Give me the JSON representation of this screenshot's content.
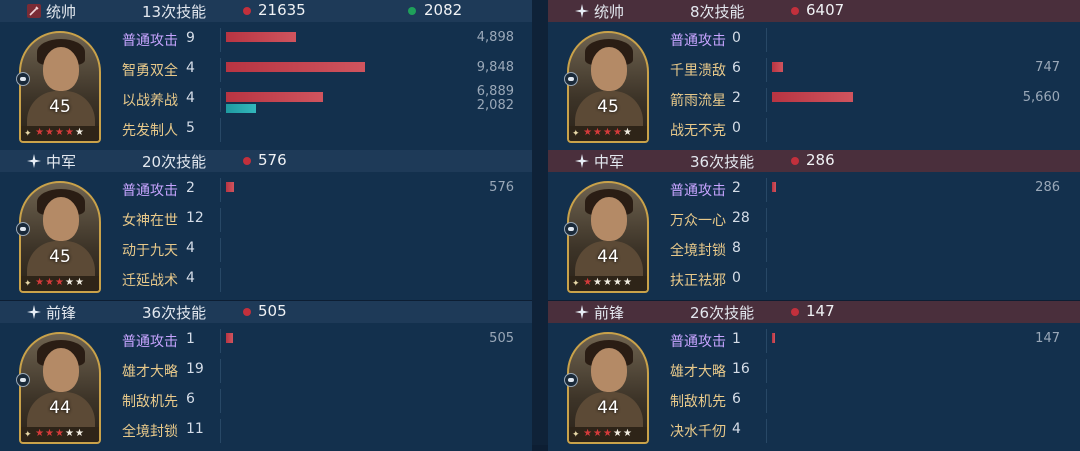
{
  "colors": {
    "damage_dot": "#c2303c",
    "heal_dot": "#1fa05a",
    "damage_bar": "#c2404b",
    "heal_bar": "#22a8ad",
    "basic_skill": "#c7a4ff",
    "skill": "#e8c98a"
  },
  "left": [
    {
      "role": "统帅",
      "role_icon": "sword-icon",
      "skills": "13次技能",
      "damage": "21635",
      "heal": "2082",
      "level": "45",
      "stars_red": 4,
      "stars_total": 5,
      "rows": [
        {
          "skill": "普通攻击",
          "basic": true,
          "count": "9",
          "value": "4,898",
          "fraction": 0.3
        },
        {
          "skill": "智勇双全",
          "basic": false,
          "count": "4",
          "value": "9,848",
          "fraction": 0.6
        },
        {
          "skill": "以战养战",
          "basic": false,
          "count": "4",
          "value": "6,889",
          "heal_value": "2,082",
          "fraction": 0.42,
          "heal_fraction": 0.13
        },
        {
          "skill": "先发制人",
          "basic": false,
          "count": "5"
        }
      ]
    },
    {
      "role": "中军",
      "role_icon": "spark-icon",
      "skills": "20次技能",
      "damage": "576",
      "level": "45",
      "stars_red": 3,
      "stars_total": 5,
      "rows": [
        {
          "skill": "普通攻击",
          "basic": true,
          "count": "2",
          "value": "576",
          "fraction": 0.035
        },
        {
          "skill": "女神在世",
          "basic": false,
          "count": "12"
        },
        {
          "skill": "动于九天",
          "basic": false,
          "count": "4"
        },
        {
          "skill": "迁延战术",
          "basic": false,
          "count": "4"
        }
      ]
    },
    {
      "role": "前锋",
      "role_icon": "spark-icon",
      "skills": "36次技能",
      "damage": "505",
      "level": "44",
      "stars_red": 3,
      "stars_total": 5,
      "rows": [
        {
          "skill": "普通攻击",
          "basic": true,
          "count": "1",
          "value": "505",
          "fraction": 0.031
        },
        {
          "skill": "雄才大略",
          "basic": false,
          "count": "19"
        },
        {
          "skill": "制敌机先",
          "basic": false,
          "count": "6"
        },
        {
          "skill": "全境封锁",
          "basic": false,
          "count": "11"
        }
      ]
    }
  ],
  "right": [
    {
      "role": "统帅",
      "role_icon": "spark-icon",
      "skills": "8次技能",
      "damage": "6407",
      "level": "45",
      "stars_red": 4,
      "stars_total": 5,
      "rows": [
        {
          "skill": "普通攻击",
          "basic": true,
          "count": "0"
        },
        {
          "skill": "千里溃敌",
          "basic": false,
          "count": "6",
          "value": "747",
          "fraction": 0.046
        },
        {
          "skill": "箭雨流星",
          "basic": false,
          "count": "2",
          "value": "5,660",
          "fraction": 0.35
        },
        {
          "skill": "战无不克",
          "basic": false,
          "count": "0"
        }
      ]
    },
    {
      "role": "中军",
      "role_icon": "spark-icon",
      "skills": "36次技能",
      "damage": "286",
      "level": "44",
      "stars_red": 1,
      "stars_total": 5,
      "rows": [
        {
          "skill": "普通攻击",
          "basic": true,
          "count": "2",
          "value": "286",
          "fraction": 0.017
        },
        {
          "skill": "万众一心",
          "basic": false,
          "count": "28"
        },
        {
          "skill": "全境封锁",
          "basic": false,
          "count": "8"
        },
        {
          "skill": "扶正祛邪",
          "basic": false,
          "count": "0"
        }
      ]
    },
    {
      "role": "前锋",
      "role_icon": "spark-icon",
      "skills": "26次技能",
      "damage": "147",
      "level": "44",
      "stars_red": 3,
      "stars_total": 5,
      "rows": [
        {
          "skill": "普通攻击",
          "basic": true,
          "count": "1",
          "value": "147",
          "fraction": 0.009
        },
        {
          "skill": "雄才大略",
          "basic": false,
          "count": "16"
        },
        {
          "skill": "制敌机先",
          "basic": false,
          "count": "6"
        },
        {
          "skill": "决水千仞",
          "basic": false,
          "count": "4"
        }
      ]
    }
  ]
}
